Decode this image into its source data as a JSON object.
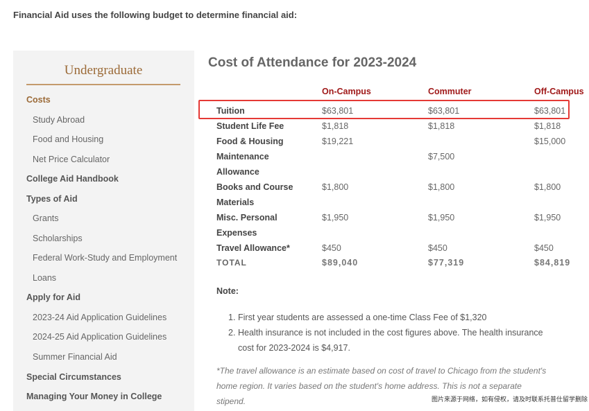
{
  "intro": "Financial Aid uses the following budget to determine financial aid:",
  "sidebar": {
    "title": "Undergraduate",
    "items": [
      {
        "label": "Costs",
        "level": "active"
      },
      {
        "label": "Study Abroad",
        "level": "sub"
      },
      {
        "label": "Food and Housing",
        "level": "sub"
      },
      {
        "label": "Net Price Calculator",
        "level": "sub"
      },
      {
        "label": "College Aid Handbook",
        "level": "top"
      },
      {
        "label": "Types of Aid",
        "level": "top"
      },
      {
        "label": "Grants",
        "level": "sub"
      },
      {
        "label": "Scholarships",
        "level": "sub"
      },
      {
        "label": "Federal Work-Study and Employment",
        "level": "sub"
      },
      {
        "label": "Loans",
        "level": "sub"
      },
      {
        "label": "Apply for Aid",
        "level": "top"
      },
      {
        "label": "2023-24 Aid Application Guidelines",
        "level": "sub"
      },
      {
        "label": "2024-25 Aid Application Guidelines",
        "level": "sub"
      },
      {
        "label": "Summer Financial Aid",
        "level": "sub"
      },
      {
        "label": "Special Circumstances",
        "level": "top"
      },
      {
        "label": "Managing Your Money in College",
        "level": "top"
      }
    ]
  },
  "main": {
    "title": "Cost of Attendance for 2023-2024",
    "columns": [
      "On-Campus",
      "Commuter",
      "Off-Campus"
    ],
    "rows": [
      {
        "label": [
          "Tuition"
        ],
        "values": [
          "$63,801",
          "$63,801",
          "$63,801"
        ]
      },
      {
        "label": [
          "Student Life Fee"
        ],
        "values": [
          "$1,818",
          "$1,818",
          "$1,818"
        ]
      },
      {
        "label": [
          "Food & Housing"
        ],
        "values": [
          "$19,221",
          "",
          "$15,000"
        ]
      },
      {
        "label": [
          "Maintenance",
          "Allowance"
        ],
        "values": [
          "",
          "$7,500",
          ""
        ]
      },
      {
        "label": [
          "Books and Course",
          "Materials"
        ],
        "values": [
          "$1,800",
          "$1,800",
          "$1,800"
        ]
      },
      {
        "label": [
          "Misc. Personal",
          "Expenses"
        ],
        "values": [
          "$1,950",
          "$1,950",
          "$1,950"
        ]
      },
      {
        "label": [
          "Travel Allowance*"
        ],
        "values": [
          "$450",
          "$450",
          "$450"
        ]
      }
    ],
    "total": {
      "label": "TOTAL",
      "values": [
        "$89,040",
        "$77,319",
        "$84,819"
      ]
    },
    "note_title": "Note:",
    "notes": [
      "First year students are assessed a one-time Class Fee of $1,320",
      "Health insurance is not included in the cost figures above. The health insurance cost for 2023-2024 is $4,917."
    ],
    "footnote": "*The travel allowance is an estimate based on cost of travel to Chicago from the student's home region. It varies based on the student's home address. This is not a separate stipend."
  },
  "watermark": "图片来源于网络，如有侵权，请及时联系托普仕留学删除",
  "colors": {
    "accent": "#9b6a37",
    "header_red": "#a01a1a",
    "highlight": "#e53935"
  }
}
